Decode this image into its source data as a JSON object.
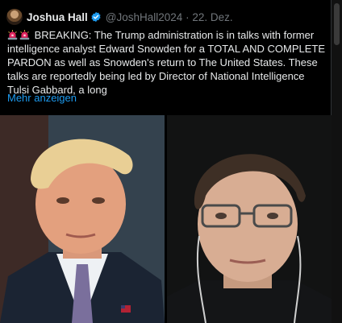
{
  "tweet": {
    "author_name": "Joshua Hall",
    "handle": "@JoshHall2024",
    "separator": "·",
    "date": "22. Dez.",
    "text": "BREAKING: The Trump administration is in talks with former intelligence analyst Edward Snowden for a TOTAL AND COMPLETE PARDON as well as Snowden's return to The United States. These talks are reportedly being led by Director of National Intelligence Tulsi Gabbard, a long",
    "show_more": "Mehr anzeigen"
  },
  "icons": {
    "verified": "verified-badge-icon",
    "siren": "police-siren-icon"
  },
  "colors": {
    "background": "#000000",
    "text": "#e7e9ea",
    "muted": "#71767b",
    "link": "#1d9bf0",
    "verified": "#1d9bf0",
    "siren": "#e0245e"
  }
}
